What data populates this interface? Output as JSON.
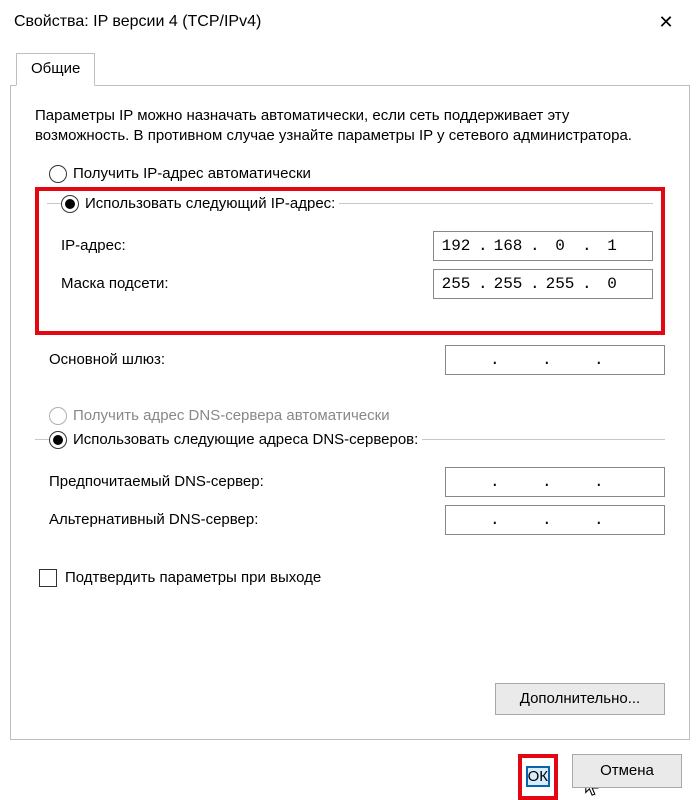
{
  "window": {
    "title": "Свойства: IP версии 4 (TCP/IPv4)"
  },
  "tab": {
    "general": "Общие"
  },
  "intro": "Параметры IP можно назначать автоматически, если сеть поддерживает эту возможность. В противном случае узнайте параметры IP у сетевого администратора.",
  "ip_section": {
    "auto_label": "Получить IP-адрес автоматически",
    "manual_label": "Использовать следующий IP-адрес:",
    "fields": {
      "ip_label": "IP-адрес:",
      "ip": {
        "o1": "192",
        "o2": "168",
        "o3": "0",
        "o4": "1"
      },
      "mask_label": "Маска подсети:",
      "mask": {
        "o1": "255",
        "o2": "255",
        "o3": "255",
        "o4": "0"
      },
      "gateway_label": "Основной шлюз:",
      "gateway": {
        "o1": "",
        "o2": "",
        "o3": "",
        "o4": ""
      }
    }
  },
  "dns_section": {
    "auto_label": "Получить адрес DNS-сервера автоматически",
    "manual_label": "Использовать следующие адреса DNS-серверов:",
    "fields": {
      "pref_label": "Предпочитаемый DNS-сервер:",
      "pref": {
        "o1": "",
        "o2": "",
        "o3": "",
        "o4": ""
      },
      "alt_label": "Альтернативный DNS-сервер:",
      "alt": {
        "o1": "",
        "o2": "",
        "o3": "",
        "o4": ""
      }
    }
  },
  "validate_checkbox": "Подтвердить параметры при выходе",
  "buttons": {
    "advanced": "Дополнительно...",
    "ok": "ОК",
    "cancel": "Отмена"
  }
}
